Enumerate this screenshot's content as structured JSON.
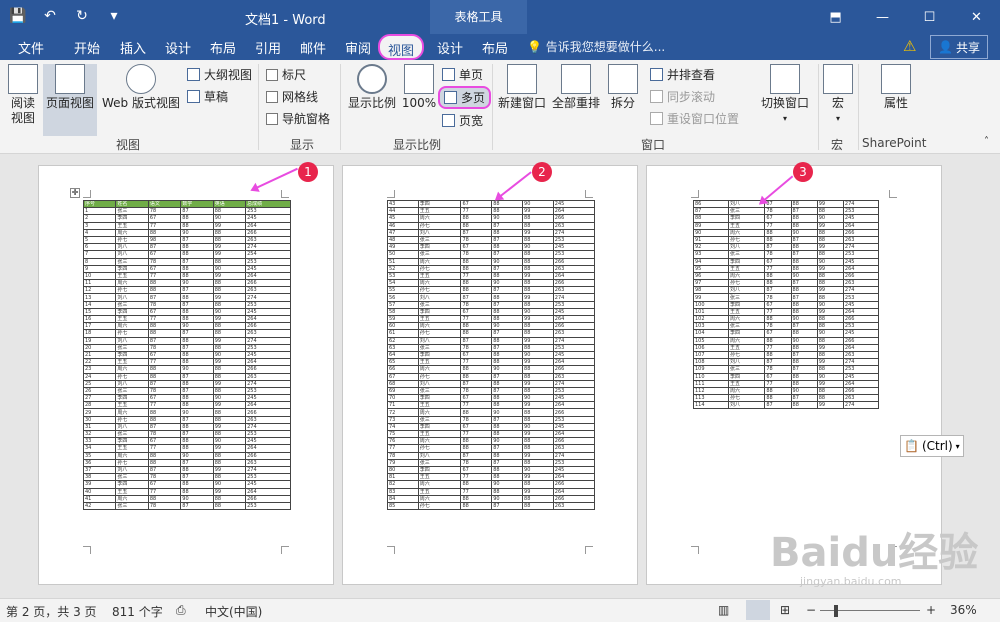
{
  "titlebar": {
    "doc_title": "文档1 - Word",
    "context_tools": "表格工具",
    "qat": {
      "save": "💾",
      "undo": "↶",
      "redo": "↻",
      "more": "▾"
    },
    "win": {
      "restore_ribbon": "⬒",
      "minimize": "—",
      "maximize": "☐",
      "close": "✕"
    }
  },
  "tabs": {
    "file": "文件",
    "home": "开始",
    "insert": "插入",
    "design": "设计",
    "layout": "布局",
    "references": "引用",
    "mailings": "邮件",
    "review": "审阅",
    "view": "视图",
    "table_design": "设计",
    "table_layout": "布局",
    "tell_me": "告诉我您想要做什么...",
    "share": "共享"
  },
  "ribbon": {
    "views": {
      "read": "阅读\n视图",
      "print_layout": "页面视图",
      "web_layout": "Web 版式视图",
      "outline": "大纲视图",
      "draft": "草稿",
      "label": "视图"
    },
    "show": {
      "ruler": "标尺",
      "gridlines": "网格线",
      "nav_pane": "导航窗格",
      "label": "显示"
    },
    "zoom": {
      "zoom": "显示比例",
      "hundred": "100%",
      "one_page": "单页",
      "multi_page": "多页",
      "page_width": "页宽",
      "label": "显示比例"
    },
    "window": {
      "new_window": "新建窗口",
      "arrange_all": "全部重排",
      "split": "拆分",
      "side_by_side": "并排查看",
      "sync_scroll": "同步滚动",
      "reset_pos": "重设窗口位置",
      "switch_windows": "切换窗口",
      "label": "窗口"
    },
    "macros": {
      "macros": "宏",
      "label": "宏"
    },
    "sharepoint": {
      "properties": "属性",
      "label": "SharePoint"
    }
  },
  "pages": {
    "markers": [
      "1",
      "2",
      "3"
    ],
    "header_row": [
      "序号",
      "姓名",
      "语文",
      "数学",
      "英语",
      "总成绩"
    ],
    "page1_rows": [
      [
        "1",
        "张三",
        "78",
        "87",
        "88",
        "253"
      ],
      [
        "2",
        "李四",
        "67",
        "88",
        "90",
        "245"
      ],
      [
        "3",
        "王五",
        "77",
        "88",
        "99",
        "264"
      ],
      [
        "4",
        "周六",
        "88",
        "90",
        "88",
        "266"
      ],
      [
        "5",
        "孙七",
        "98",
        "87",
        "88",
        "263"
      ],
      [
        "6",
        "刘八",
        "87",
        "88",
        "99",
        "274"
      ],
      [
        "7",
        "刘八",
        "67",
        "88",
        "99",
        "254"
      ],
      [
        "8",
        "张三",
        "78",
        "87",
        "88",
        "253"
      ],
      [
        "9",
        "李四",
        "67",
        "88",
        "90",
        "245"
      ],
      [
        "10",
        "王五",
        "77",
        "88",
        "99",
        "264"
      ],
      [
        "11",
        "周六",
        "88",
        "90",
        "88",
        "266"
      ],
      [
        "12",
        "孙七",
        "88",
        "87",
        "88",
        "263"
      ],
      [
        "13",
        "刘八",
        "87",
        "88",
        "99",
        "274"
      ],
      [
        "14",
        "张三",
        "78",
        "87",
        "88",
        "253"
      ],
      [
        "15",
        "李四",
        "67",
        "88",
        "90",
        "245"
      ],
      [
        "16",
        "王五",
        "77",
        "88",
        "99",
        "264"
      ],
      [
        "17",
        "周六",
        "88",
        "90",
        "88",
        "266"
      ],
      [
        "18",
        "孙七",
        "88",
        "87",
        "88",
        "263"
      ],
      [
        "19",
        "刘八",
        "87",
        "88",
        "99",
        "274"
      ],
      [
        "20",
        "张三",
        "78",
        "87",
        "88",
        "253"
      ],
      [
        "21",
        "李四",
        "67",
        "88",
        "90",
        "245"
      ],
      [
        "22",
        "王五",
        "77",
        "88",
        "99",
        "264"
      ],
      [
        "23",
        "周六",
        "88",
        "90",
        "88",
        "266"
      ],
      [
        "24",
        "孙七",
        "88",
        "87",
        "88",
        "263"
      ],
      [
        "25",
        "刘八",
        "87",
        "88",
        "99",
        "274"
      ],
      [
        "26",
        "张三",
        "78",
        "87",
        "88",
        "253"
      ],
      [
        "27",
        "李四",
        "67",
        "88",
        "90",
        "245"
      ],
      [
        "28",
        "王五",
        "77",
        "88",
        "99",
        "264"
      ],
      [
        "29",
        "周六",
        "88",
        "90",
        "88",
        "266"
      ],
      [
        "30",
        "孙七",
        "88",
        "87",
        "88",
        "263"
      ],
      [
        "31",
        "刘八",
        "87",
        "88",
        "99",
        "274"
      ],
      [
        "32",
        "张三",
        "78",
        "87",
        "88",
        "253"
      ],
      [
        "33",
        "李四",
        "67",
        "88",
        "90",
        "245"
      ],
      [
        "34",
        "王五",
        "77",
        "88",
        "99",
        "264"
      ],
      [
        "35",
        "周六",
        "88",
        "90",
        "88",
        "266"
      ],
      [
        "36",
        "孙七",
        "88",
        "87",
        "88",
        "263"
      ],
      [
        "37",
        "刘八",
        "87",
        "88",
        "99",
        "274"
      ],
      [
        "38",
        "张三",
        "78",
        "87",
        "88",
        "253"
      ],
      [
        "39",
        "李四",
        "67",
        "88",
        "90",
        "245"
      ],
      [
        "40",
        "王五",
        "77",
        "88",
        "99",
        "264"
      ],
      [
        "41",
        "周六",
        "88",
        "90",
        "88",
        "266"
      ],
      [
        "42",
        "张三",
        "78",
        "87",
        "88",
        "253"
      ]
    ],
    "page2_rows": [
      [
        "43",
        "李四",
        "67",
        "88",
        "90",
        "245"
      ],
      [
        "44",
        "王五",
        "77",
        "88",
        "99",
        "264"
      ],
      [
        "45",
        "周六",
        "88",
        "90",
        "88",
        "266"
      ],
      [
        "46",
        "孙七",
        "88",
        "87",
        "88",
        "263"
      ],
      [
        "47",
        "刘八",
        "87",
        "88",
        "99",
        "274"
      ],
      [
        "48",
        "张三",
        "78",
        "87",
        "88",
        "253"
      ],
      [
        "49",
        "李四",
        "67",
        "88",
        "90",
        "245"
      ],
      [
        "50",
        "张三",
        "78",
        "87",
        "88",
        "253"
      ],
      [
        "51",
        "周六",
        "88",
        "90",
        "88",
        "266"
      ],
      [
        "52",
        "孙七",
        "88",
        "87",
        "88",
        "263"
      ],
      [
        "53",
        "王五",
        "77",
        "88",
        "99",
        "264"
      ],
      [
        "54",
        "周六",
        "88",
        "90",
        "88",
        "266"
      ],
      [
        "55",
        "孙七",
        "88",
        "87",
        "88",
        "263"
      ],
      [
        "56",
        "刘八",
        "87",
        "88",
        "99",
        "274"
      ],
      [
        "57",
        "张三",
        "78",
        "87",
        "88",
        "253"
      ],
      [
        "58",
        "李四",
        "67",
        "88",
        "90",
        "245"
      ],
      [
        "59",
        "王五",
        "77",
        "88",
        "99",
        "264"
      ],
      [
        "60",
        "周六",
        "88",
        "90",
        "88",
        "266"
      ],
      [
        "61",
        "孙七",
        "88",
        "87",
        "88",
        "263"
      ],
      [
        "62",
        "刘八",
        "87",
        "88",
        "99",
        "274"
      ],
      [
        "63",
        "张三",
        "78",
        "87",
        "88",
        "253"
      ],
      [
        "64",
        "李四",
        "67",
        "88",
        "90",
        "245"
      ],
      [
        "65",
        "王五",
        "77",
        "88",
        "99",
        "264"
      ],
      [
        "66",
        "周六",
        "88",
        "90",
        "88",
        "266"
      ],
      [
        "67",
        "孙七",
        "88",
        "87",
        "88",
        "263"
      ],
      [
        "68",
        "刘八",
        "87",
        "88",
        "99",
        "274"
      ],
      [
        "69",
        "张三",
        "78",
        "87",
        "88",
        "253"
      ],
      [
        "70",
        "李四",
        "67",
        "88",
        "90",
        "245"
      ],
      [
        "71",
        "王五",
        "77",
        "88",
        "99",
        "264"
      ],
      [
        "72",
        "周六",
        "88",
        "90",
        "88",
        "266"
      ],
      [
        "73",
        "张三",
        "78",
        "87",
        "88",
        "253"
      ],
      [
        "74",
        "李四",
        "67",
        "88",
        "90",
        "245"
      ],
      [
        "75",
        "王五",
        "77",
        "88",
        "99",
        "264"
      ],
      [
        "76",
        "周六",
        "88",
        "90",
        "88",
        "266"
      ],
      [
        "77",
        "孙七",
        "88",
        "87",
        "88",
        "263"
      ],
      [
        "78",
        "刘八",
        "87",
        "88",
        "99",
        "274"
      ],
      [
        "79",
        "张三",
        "78",
        "87",
        "88",
        "253"
      ],
      [
        "80",
        "李四",
        "67",
        "88",
        "90",
        "245"
      ],
      [
        "81",
        "王五",
        "77",
        "88",
        "99",
        "264"
      ],
      [
        "82",
        "周六",
        "88",
        "90",
        "88",
        "266"
      ],
      [
        "83",
        "王五",
        "77",
        "88",
        "99",
        "264"
      ],
      [
        "84",
        "周六",
        "88",
        "90",
        "88",
        "266"
      ],
      [
        "85",
        "孙七",
        "88",
        "87",
        "88",
        "263"
      ]
    ],
    "page3_rows": [
      [
        "86",
        "刘八",
        "87",
        "88",
        "99",
        "274"
      ],
      [
        "87",
        "张三",
        "78",
        "87",
        "88",
        "253"
      ],
      [
        "88",
        "李四",
        "67",
        "88",
        "90",
        "245"
      ],
      [
        "89",
        "王五",
        "77",
        "88",
        "99",
        "264"
      ],
      [
        "90",
        "周六",
        "88",
        "90",
        "88",
        "266"
      ],
      [
        "91",
        "孙七",
        "88",
        "87",
        "88",
        "263"
      ],
      [
        "92",
        "刘八",
        "87",
        "88",
        "99",
        "274"
      ],
      [
        "93",
        "张三",
        "78",
        "87",
        "88",
        "253"
      ],
      [
        "94",
        "李四",
        "67",
        "88",
        "90",
        "245"
      ],
      [
        "95",
        "王五",
        "77",
        "88",
        "99",
        "264"
      ],
      [
        "96",
        "周六",
        "88",
        "90",
        "88",
        "266"
      ],
      [
        "97",
        "孙七",
        "88",
        "87",
        "88",
        "263"
      ],
      [
        "98",
        "刘八",
        "87",
        "88",
        "99",
        "274"
      ],
      [
        "99",
        "张三",
        "78",
        "87",
        "88",
        "253"
      ],
      [
        "100",
        "李四",
        "67",
        "88",
        "90",
        "245"
      ],
      [
        "101",
        "王五",
        "77",
        "88",
        "99",
        "264"
      ],
      [
        "102",
        "周六",
        "88",
        "90",
        "88",
        "266"
      ],
      [
        "103",
        "张三",
        "78",
        "87",
        "88",
        "253"
      ],
      [
        "104",
        "李四",
        "67",
        "88",
        "90",
        "245"
      ],
      [
        "105",
        "周六",
        "88",
        "90",
        "88",
        "266"
      ],
      [
        "106",
        "王五",
        "77",
        "88",
        "99",
        "264"
      ],
      [
        "107",
        "孙七",
        "88",
        "87",
        "88",
        "263"
      ],
      [
        "108",
        "刘八",
        "87",
        "88",
        "99",
        "274"
      ],
      [
        "109",
        "张三",
        "78",
        "87",
        "88",
        "253"
      ],
      [
        "110",
        "李四",
        "67",
        "88",
        "90",
        "245"
      ],
      [
        "111",
        "王五",
        "77",
        "88",
        "99",
        "264"
      ],
      [
        "112",
        "周六",
        "88",
        "90",
        "88",
        "266"
      ],
      [
        "113",
        "孙七",
        "88",
        "87",
        "88",
        "263"
      ],
      [
        "114",
        "刘八",
        "87",
        "88",
        "99",
        "274"
      ]
    ],
    "paste_options": "(Ctrl)"
  },
  "statusbar": {
    "page_info": "第 2 页，共 3 页",
    "word_count": "811 个字",
    "language": "中文(中国)",
    "zoom_minus": "−",
    "zoom_plus": "+",
    "zoom_level": "36%"
  },
  "watermark": {
    "brand": "Baidu经验",
    "url": "jingyan.baidu.com"
  },
  "colors": {
    "word_blue": "#2b579a",
    "table_header": "#70ad47",
    "annotation": "#e84ce0",
    "marker": "#e8254c"
  }
}
